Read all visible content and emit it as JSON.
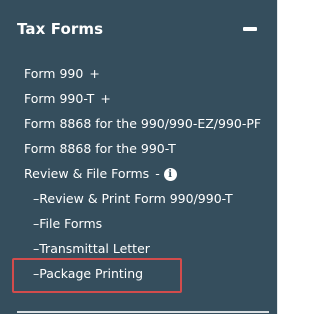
{
  "panel": {
    "title": "Tax Forms",
    "collapse_icon": "minus-icon"
  },
  "menu": [
    {
      "label": "Form 990",
      "suffix": "+"
    },
    {
      "label": "Form 990-T",
      "suffix": "+"
    },
    {
      "label": "Form 8868 for the 990/990-EZ/990-PF"
    },
    {
      "label": "Form 8868 for the 990-T"
    },
    {
      "label": "Review & File Forms",
      "suffix": "-",
      "icon": "info-icon"
    }
  ],
  "submenu": [
    {
      "label": "–Review & Print Form 990/990-T"
    },
    {
      "label": "–File Forms"
    },
    {
      "label": "–Transmittal Letter"
    },
    {
      "label": "–Package Printing",
      "highlighted": true
    }
  ],
  "colors": {
    "panel_bg": "#354e5d",
    "text": "#ffffff",
    "highlight_border": "#d24c4c"
  }
}
